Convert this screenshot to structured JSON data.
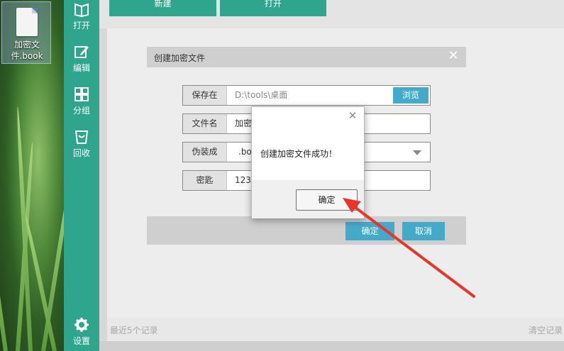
{
  "desktop": {
    "file_label": "加密文件.book"
  },
  "sidebar": {
    "items": [
      {
        "label": "打开",
        "icon": "book-open-icon"
      },
      {
        "label": "编辑",
        "icon": "edit-icon"
      },
      {
        "label": "分组",
        "icon": "grid-icon"
      },
      {
        "label": "回收",
        "icon": "trash-bag-icon"
      },
      {
        "label": "设置",
        "icon": "gear-icon"
      }
    ]
  },
  "toolbar": {
    "new_label": "新建",
    "open_label": "打开"
  },
  "footer": {
    "recent_label": "最近5个记录",
    "clear_label": "清空记录"
  },
  "create_dialog": {
    "title": "创建加密文件",
    "save_label": "保存在",
    "save_path": "D:\\tools\\桌面",
    "browse_label": "浏览",
    "filename_label": "文件名",
    "filename_value": "加密",
    "disguise_label": "伪装成",
    "disguise_value": ".bo",
    "password_label": "密匙",
    "password_value": "1233",
    "confirm_label": "确定",
    "cancel_label": "取消"
  },
  "message_box": {
    "message": "创建加密文件成功！",
    "ok_label": "确定"
  },
  "colors": {
    "accent": "#2ea58c",
    "button_blue": "#45a9c9",
    "arrow_red": "#e8352b"
  }
}
